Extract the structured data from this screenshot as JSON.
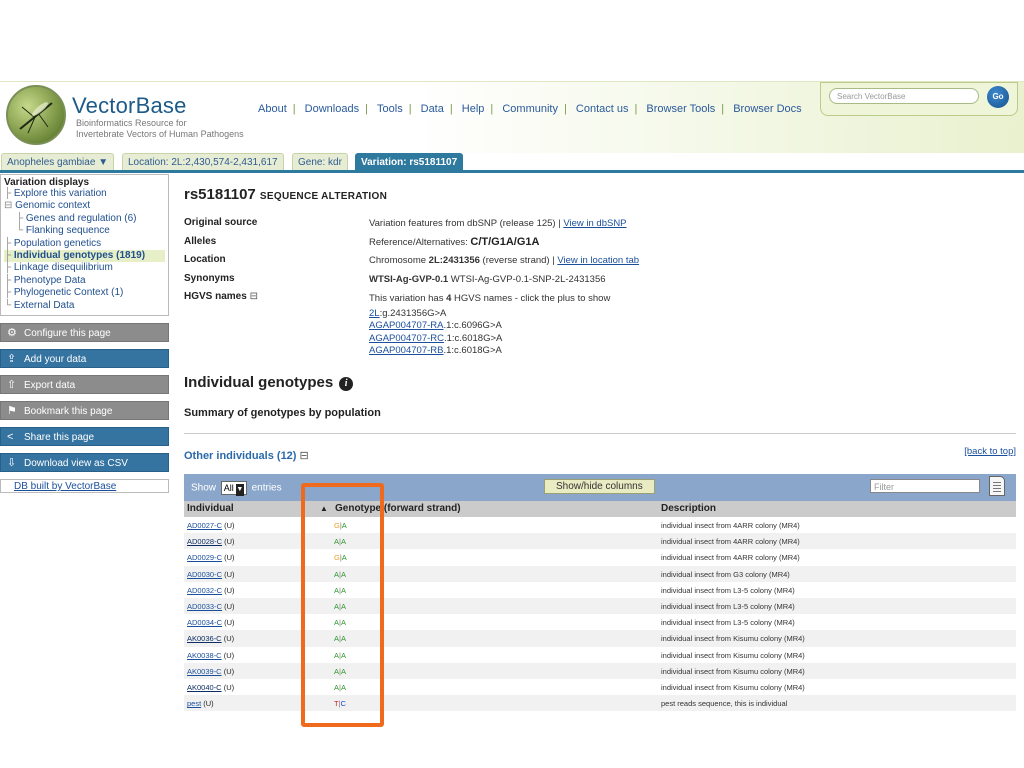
{
  "header": {
    "brand": "VectorBase",
    "tagline_1": "Bioinformatics Resource for",
    "tagline_2": "Invertebrate Vectors of Human Pathogens",
    "nav": [
      "About",
      "Downloads",
      "Tools",
      "Data",
      "Help",
      "Community",
      "Contact us",
      "Browser Tools",
      "Browser Docs"
    ],
    "search_placeholder": "Search VectorBase",
    "search_button": "Go"
  },
  "tabs": {
    "species": "Anopheles gambiae",
    "species_arrow": "▼",
    "location": "Location: 2L:2,430,574-2,431,617",
    "gene": "Gene: kdr",
    "variation": "Variation: rs5181107"
  },
  "sidebar": {
    "title": "Variation displays",
    "items": [
      "Explore this variation",
      "Genomic context",
      "Genes and regulation (6)",
      "Flanking sequence",
      "Population genetics",
      "Individual genotypes (1819)",
      "Linkage disequilibrium",
      "Phenotype Data",
      "Phylogenetic Context (1)",
      "External Data"
    ],
    "tools": [
      "Configure this page",
      "Add your data",
      "Export data",
      "Bookmark this page",
      "Share this page",
      "Download view as CSV"
    ],
    "db_built": "DB built by VectorBase"
  },
  "main": {
    "title_id": "rs5181107",
    "title_type": "SEQUENCE ALTERATION",
    "fields": {
      "original_source_label": "Original source",
      "original_source_text": "Variation features from dbSNP (release 125) | ",
      "original_source_link": "View in dbSNP",
      "alleles_label": "Alleles",
      "alleles_text": "Reference/Alternatives: ",
      "alleles_value": "C/T/G1A/G1A",
      "location_label": "Location",
      "location_prefix": "Chromosome ",
      "location_value": "2L:2431356",
      "location_suffix": " (reverse strand) | ",
      "location_link": "View in location tab",
      "synonyms_label": "Synonyms",
      "synonyms_bold": "WTSI-Ag-GVP-0.1",
      "synonyms_rest": " WTSI-Ag-GVP-0.1-SNP-2L-2431356",
      "hgvs_label": "HGVS names",
      "hgvs_toggle": "⊟",
      "hgvs_intro_1": "This variation has ",
      "hgvs_count": "4",
      "hgvs_intro_2": " HGVS names - click the plus to show",
      "hgvs_names": [
        {
          "link": "2L",
          "rest": ":g.2431356G>A"
        },
        {
          "link": "AGAP004707-RA",
          "rest": ".1:c.6096G>A"
        },
        {
          "link": "AGAP004707-RC",
          "rest": ".1:c.6018G>A"
        },
        {
          "link": "AGAP004707-RB",
          "rest": ".1:c.6018G>A"
        }
      ]
    },
    "section_title": "Individual genotypes",
    "info_icon": "i",
    "summary": "Summary of genotypes by population",
    "other_individuals": "Other individuals (12)",
    "other_toggle": "⊟",
    "back_to_top": "[back to top]"
  },
  "table": {
    "show_label": "Show",
    "show_value": "All",
    "entries_label": "entries",
    "show_hide_button": "Show/hide columns",
    "filter_placeholder": "Filter",
    "headers": {
      "individual": "Individual",
      "sort_arrow": "▲",
      "genotype": "Genotype (forward strand)",
      "description": "Description"
    },
    "rows": [
      {
        "id": "AD0027-C",
        "tag": " (U)",
        "a1": "G",
        "a2": "A",
        "desc": "individual insect from 4ARR colony (MR4)",
        "bold": false
      },
      {
        "id": "AD0028-C",
        "tag": " (U)",
        "a1": "A",
        "a2": "A",
        "desc": "individual insect from 4ARR colony (MR4)",
        "bold": true
      },
      {
        "id": "AD0029-C",
        "tag": " (U)",
        "a1": "G",
        "a2": "A",
        "desc": "individual insect from 4ARR colony (MR4)",
        "bold": false
      },
      {
        "id": "AD0030-C",
        "tag": " (U)",
        "a1": "A",
        "a2": "A",
        "desc": "individual insect from G3 colony (MR4)",
        "bold": false
      },
      {
        "id": "AD0032-C",
        "tag": " (U)",
        "a1": "A",
        "a2": "A",
        "desc": "individual insect from L3-5 colony (MR4)",
        "bold": false
      },
      {
        "id": "AD0033-C",
        "tag": " (U)",
        "a1": "A",
        "a2": "A",
        "desc": "individual insect from L3-5 colony (MR4)",
        "bold": false
      },
      {
        "id": "AD0034-C",
        "tag": " (U)",
        "a1": "A",
        "a2": "A",
        "desc": "individual insect from L3-5 colony (MR4)",
        "bold": false
      },
      {
        "id": "AK0036-C",
        "tag": " (U)",
        "a1": "A",
        "a2": "A",
        "desc": "individual insect from Kisumu colony (MR4)",
        "bold": true
      },
      {
        "id": "AK0038-C",
        "tag": " (U)",
        "a1": "A",
        "a2": "A",
        "desc": "individual insect from Kisumu colony (MR4)",
        "bold": false
      },
      {
        "id": "AK0039-C",
        "tag": " (U)",
        "a1": "A",
        "a2": "A",
        "desc": "individual insect from Kisumu colony (MR4)",
        "bold": false
      },
      {
        "id": "AK0040-C",
        "tag": " (U)",
        "a1": "A",
        "a2": "A",
        "desc": "individual insect from Kisumu colony (MR4)",
        "bold": true
      },
      {
        "id": "pest",
        "tag": " (U)",
        "a1": "T",
        "a2": "C",
        "desc": "pest reads sequence, this is individual",
        "bold": false
      }
    ]
  },
  "colors": {
    "highlight": "#f06a1e",
    "tab_active": "#2e7a9e",
    "allele_A": "#2a9a2a",
    "allele_G": "#e8a020",
    "allele_T": "#d42020",
    "allele_C": "#2244cc"
  },
  "icons": {
    "configure": "gear-icon",
    "add_data": "upload-icon",
    "export": "export-icon",
    "bookmark": "bookmark-icon",
    "share": "share-icon",
    "download": "download-icon"
  }
}
